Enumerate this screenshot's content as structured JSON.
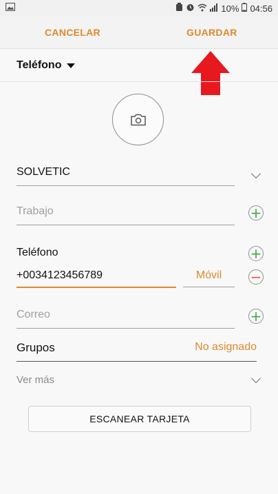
{
  "status_bar": {
    "battery": "10%",
    "time": "04:56"
  },
  "action_bar": {
    "cancel_label": "CANCELAR",
    "save_label": "GUARDAR"
  },
  "account": {
    "label": "Teléfono"
  },
  "form": {
    "name_value": "SOLVETIC",
    "company_placeholder": "Trabajo",
    "phone_label": "Teléfono",
    "phone_value": "+0034123456789",
    "phone_type": "Móvil",
    "email_placeholder": "Correo",
    "groups_label": "Grupos",
    "groups_value": "No asignado",
    "more_label": "Ver más"
  },
  "scan_button": {
    "label": "ESCANEAR TARJETA"
  },
  "colors": {
    "accent": "#e0892c",
    "add": "#45a84a",
    "remove": "#e05555",
    "arrow": "#e8181f"
  },
  "icons": [
    "gallery-icon",
    "camera-icon",
    "plus-icon",
    "minus-icon",
    "chevron-down-icon",
    "red-arrow-up-icon"
  ]
}
